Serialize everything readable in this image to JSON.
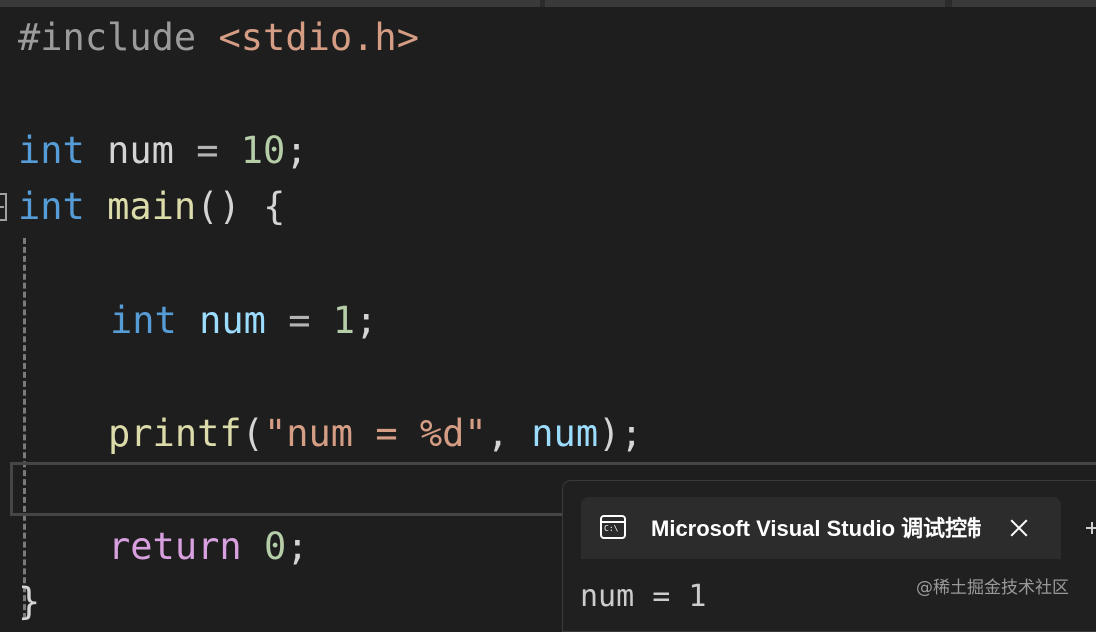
{
  "editor": {
    "lines": {
      "l1": {
        "directive": "#include",
        "header": "<stdio.h>"
      },
      "l3": {
        "type": "int",
        "name": "num",
        "assign": "=",
        "value": "10",
        "end": ";"
      },
      "l4": {
        "type": "int",
        "name": "main",
        "parens": "()",
        "brace": "{"
      },
      "l6": {
        "type": "int",
        "name": "num",
        "assign": "=",
        "value": "1",
        "end": ";"
      },
      "l8": {
        "func": "printf",
        "open": "(",
        "str": "\"num = %d\"",
        "comma": ",",
        "arg": "num",
        "close": ")",
        "end": ";"
      },
      "l10": {
        "keyword": "return",
        "value": "0",
        "end": ";"
      },
      "l11": {
        "brace": "}"
      }
    }
  },
  "console": {
    "tab_title": "Microsoft Visual Studio 调试控制台",
    "icon_text": "C:\\",
    "output": "num = 1"
  },
  "watermark": "@稀土掘金技术社区",
  "colors": {
    "background": "#1e1e1e",
    "keyword": "#569cd6",
    "function": "#dcdcaa",
    "variable": "#9cdcfe",
    "number": "#b5cea8",
    "string": "#d69d85",
    "control": "#d8a0df",
    "preprocessor": "#9b9b9b"
  }
}
